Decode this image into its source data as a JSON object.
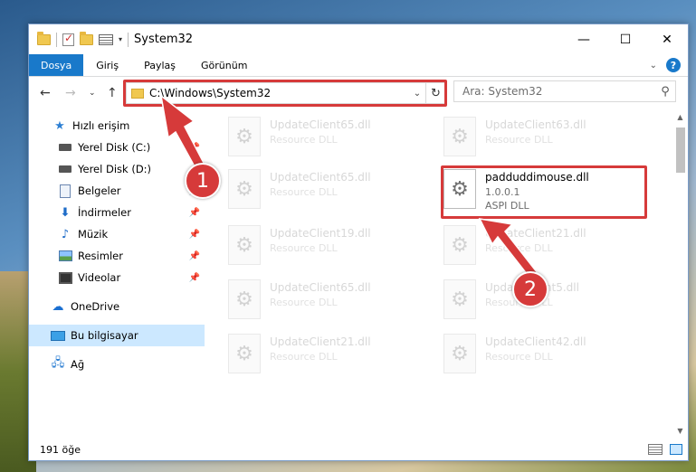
{
  "window": {
    "title": "System32",
    "controls": {
      "minimize": "—",
      "maximize": "☐",
      "close": "✕"
    }
  },
  "ribbon": {
    "tabs": [
      {
        "label": "Dosya",
        "active": true
      },
      {
        "label": "Giriş"
      },
      {
        "label": "Paylaş"
      },
      {
        "label": "Görünüm"
      }
    ],
    "help": "?"
  },
  "nav": {
    "address": "C:\\Windows\\System32",
    "search_placeholder": "Ara: System32"
  },
  "sidebar": {
    "items": [
      {
        "label": "Hızlı erişim",
        "icon": "star-icon"
      },
      {
        "label": "Yerel Disk (C:)",
        "icon": "disk-icon",
        "pinned": true
      },
      {
        "label": "Yerel Disk (D:)",
        "icon": "disk-icon"
      },
      {
        "label": "Belgeler",
        "icon": "document-icon",
        "pinned": true
      },
      {
        "label": "İndirmeler",
        "icon": "download-icon",
        "pinned": true
      },
      {
        "label": "Müzik",
        "icon": "music-icon",
        "pinned": true
      },
      {
        "label": "Resimler",
        "icon": "pictures-icon",
        "pinned": true
      },
      {
        "label": "Videolar",
        "icon": "videos-icon",
        "pinned": true
      },
      {
        "label": "OneDrive",
        "icon": "cloud-icon"
      },
      {
        "label": "Bu bilgisayar",
        "icon": "computer-icon",
        "selected": true
      },
      {
        "label": "Ağ",
        "icon": "network-icon"
      }
    ]
  },
  "files": [
    {
      "name": "UpdateClient65.dll",
      "meta": "Resource DLL"
    },
    {
      "name": "UpdateClient63.dll",
      "meta": "Resource DLL"
    },
    {
      "name": "UpdateClient65.dll",
      "meta": "Resource DLL"
    },
    {
      "name": "padduddimouse.dll",
      "version": "1.0.0.1",
      "meta": "ASPI DLL",
      "highlighted": true
    },
    {
      "name": "UpdateClient19.dll",
      "meta": "Resource DLL"
    },
    {
      "name": "UpdateClient21.dll",
      "meta": "Resource DLL"
    },
    {
      "name": "UpdateClient65.dll",
      "meta": "Resource DLL"
    },
    {
      "name": "UpdateClient5.dll",
      "meta": "Resource DLL"
    },
    {
      "name": "UpdateClient21.dll",
      "meta": "Resource DLL"
    },
    {
      "name": "UpdateClient42.dll",
      "meta": "Resource DLL"
    }
  ],
  "status": {
    "count": "191 öğe"
  },
  "callouts": {
    "one": "1",
    "two": "2"
  },
  "colors": {
    "accent": "#1979ca",
    "highlight": "#d63a3a",
    "selected": "#cce8ff"
  }
}
